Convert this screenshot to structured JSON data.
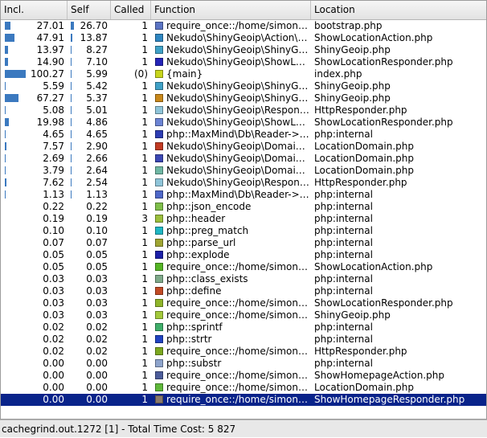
{
  "columns": [
    "Incl.",
    "Self",
    "Called",
    "Function",
    "Location"
  ],
  "rows": [
    {
      "incl": "27.01",
      "incl_pct": 0.27,
      "self": "26.70",
      "self_pct": 0.267,
      "called": "1",
      "function": "require_once::/home/simon…",
      "location": "bootstrap.php",
      "color": "#5b74c4"
    },
    {
      "incl": "47.91",
      "incl_pct": 0.479,
      "self": "13.87",
      "self_pct": 0.139,
      "called": "1",
      "function": "Nekudo\\ShinyGeoip\\Action\\…",
      "location": "ShowLocationAction.php",
      "color": "#2e86c1"
    },
    {
      "incl": "13.97",
      "incl_pct": 0.14,
      "self": "8.27",
      "self_pct": 0.083,
      "called": "1",
      "function": "Nekudo\\ShinyGeoip\\ShinyG…",
      "location": "ShinyGeoip.php",
      "color": "#3fa1c7"
    },
    {
      "incl": "14.90",
      "incl_pct": 0.149,
      "self": "7.10",
      "self_pct": 0.071,
      "called": "1",
      "function": "Nekudo\\ShinyGeoip\\ShowL…",
      "location": "ShowLocationResponder.php",
      "color": "#2424b8"
    },
    {
      "incl": "100.27",
      "incl_pct": 1.0,
      "self": "5.99",
      "self_pct": 0.06,
      "called": "(0)",
      "function": "{main}",
      "location": "index.php",
      "color": "#c8d61c"
    },
    {
      "incl": "5.59",
      "incl_pct": 0.056,
      "self": "5.42",
      "self_pct": 0.054,
      "called": "1",
      "function": "Nekudo\\ShinyGeoip\\ShinyG…",
      "location": "ShinyGeoip.php",
      "color": "#3fa1c7"
    },
    {
      "incl": "67.27",
      "incl_pct": 0.673,
      "self": "5.37",
      "self_pct": 0.054,
      "called": "1",
      "function": "Nekudo\\ShinyGeoip\\ShinyG…",
      "location": "ShinyGeoip.php",
      "color": "#c9881a"
    },
    {
      "incl": "5.08",
      "incl_pct": 0.051,
      "self": "5.01",
      "self_pct": 0.05,
      "called": "1",
      "function": "Nekudo\\ShinyGeoip\\Respon…",
      "location": "HttpResponder.php",
      "color": "#8fc5d9"
    },
    {
      "incl": "19.98",
      "incl_pct": 0.2,
      "self": "4.86",
      "self_pct": 0.049,
      "called": "1",
      "function": "Nekudo\\ShinyGeoip\\ShowL…",
      "location": "ShowLocationResponder.php",
      "color": "#6c84d4"
    },
    {
      "incl": "4.65",
      "incl_pct": 0.047,
      "self": "4.65",
      "self_pct": 0.047,
      "called": "1",
      "function": "php::MaxMind\\Db\\Reader->…",
      "location": "php:internal",
      "color": "#2d3db3"
    },
    {
      "incl": "7.57",
      "incl_pct": 0.076,
      "self": "2.90",
      "self_pct": 0.029,
      "called": "1",
      "function": "Nekudo\\ShinyGeoip\\Domai…",
      "location": "LocationDomain.php",
      "color": "#c23a22"
    },
    {
      "incl": "2.69",
      "incl_pct": 0.027,
      "self": "2.66",
      "self_pct": 0.027,
      "called": "1",
      "function": "Nekudo\\ShinyGeoip\\Domai…",
      "location": "LocationDomain.php",
      "color": "#3b47b4"
    },
    {
      "incl": "3.79",
      "incl_pct": 0.038,
      "self": "2.64",
      "self_pct": 0.026,
      "called": "1",
      "function": "Nekudo\\ShinyGeoip\\Domai…",
      "location": "LocationDomain.php",
      "color": "#6fb7a4"
    },
    {
      "incl": "7.62",
      "incl_pct": 0.076,
      "self": "2.54",
      "self_pct": 0.025,
      "called": "1",
      "function": "Nekudo\\ShinyGeoip\\Respon…",
      "location": "HttpResponder.php",
      "color": "#8fc5d9"
    },
    {
      "incl": "1.13",
      "incl_pct": 0.011,
      "self": "1.13",
      "self_pct": 0.011,
      "called": "1",
      "function": "php::MaxMind\\Db\\Reader->…",
      "location": "php:internal",
      "color": "#4f68c9"
    },
    {
      "incl": "0.22",
      "incl_pct": 0.002,
      "self": "0.22",
      "self_pct": 0.002,
      "called": "1",
      "function": "php::json_encode",
      "location": "php:internal",
      "color": "#7fbf4a"
    },
    {
      "incl": "0.19",
      "incl_pct": 0.002,
      "self": "0.19",
      "self_pct": 0.002,
      "called": "3",
      "function": "php::header",
      "location": "php:internal",
      "color": "#9bbf3c"
    },
    {
      "incl": "0.10",
      "incl_pct": 0.001,
      "self": "0.10",
      "self_pct": 0.001,
      "called": "1",
      "function": "php::preg_match",
      "location": "php:internal",
      "color": "#1fb7c4"
    },
    {
      "incl": "0.07",
      "incl_pct": 0.001,
      "self": "0.07",
      "self_pct": 0.001,
      "called": "1",
      "function": "php::parse_url",
      "location": "php:internal",
      "color": "#9fa532"
    },
    {
      "incl": "0.05",
      "incl_pct": 0.0,
      "self": "0.05",
      "self_pct": 0.0,
      "called": "1",
      "function": "php::explode",
      "location": "php:internal",
      "color": "#1b1fa8"
    },
    {
      "incl": "0.05",
      "incl_pct": 0.0,
      "self": "0.05",
      "self_pct": 0.0,
      "called": "1",
      "function": "require_once::/home/simon…",
      "location": "ShowLocationAction.php",
      "color": "#55b525"
    },
    {
      "incl": "0.03",
      "incl_pct": 0.0,
      "self": "0.03",
      "self_pct": 0.0,
      "called": "1",
      "function": "php::class_exists",
      "location": "php:internal",
      "color": "#7faa8a"
    },
    {
      "incl": "0.03",
      "incl_pct": 0.0,
      "self": "0.03",
      "self_pct": 0.0,
      "called": "1",
      "function": "php::define",
      "location": "php:internal",
      "color": "#c24b25"
    },
    {
      "incl": "0.03",
      "incl_pct": 0.0,
      "self": "0.03",
      "self_pct": 0.0,
      "called": "1",
      "function": "require_once::/home/simon…",
      "location": "ShowLocationResponder.php",
      "color": "#8fb52a"
    },
    {
      "incl": "0.03",
      "incl_pct": 0.0,
      "self": "0.03",
      "self_pct": 0.0,
      "called": "1",
      "function": "require_once::/home/simon…",
      "location": "ShinyGeoip.php",
      "color": "#a3c93b"
    },
    {
      "incl": "0.02",
      "incl_pct": 0.0,
      "self": "0.02",
      "self_pct": 0.0,
      "called": "1",
      "function": "php::sprintf",
      "location": "php:internal",
      "color": "#3fae6a"
    },
    {
      "incl": "0.02",
      "incl_pct": 0.0,
      "self": "0.02",
      "self_pct": 0.0,
      "called": "1",
      "function": "php::strtr",
      "location": "php:internal",
      "color": "#2043c1"
    },
    {
      "incl": "0.02",
      "incl_pct": 0.0,
      "self": "0.02",
      "self_pct": 0.0,
      "called": "1",
      "function": "require_once::/home/simon…",
      "location": "HttpResponder.php",
      "color": "#7ca81f"
    },
    {
      "incl": "0.00",
      "incl_pct": 0.0,
      "self": "0.00",
      "self_pct": 0.0,
      "called": "1",
      "function": "php::substr",
      "location": "php:internal",
      "color": "#8ea4cc"
    },
    {
      "incl": "0.00",
      "incl_pct": 0.0,
      "self": "0.00",
      "self_pct": 0.0,
      "called": "1",
      "function": "require_once::/home/simon…",
      "location": "ShowHomepageAction.php",
      "color": "#4c5c9a"
    },
    {
      "incl": "0.00",
      "incl_pct": 0.0,
      "self": "0.00",
      "self_pct": 0.0,
      "called": "1",
      "function": "require_once::/home/simon…",
      "location": "LocationDomain.php",
      "color": "#5fb83a"
    },
    {
      "incl": "0.00",
      "incl_pct": 0.0,
      "self": "0.00",
      "self_pct": 0.0,
      "called": "1",
      "function": "require_once::/home/simon…",
      "location": "ShowHomepageResponder.php",
      "color": "#8a7a6a",
      "selected": true
    }
  ],
  "status": "cachegrind.out.1272 [1] - Total Time Cost: 5 827"
}
